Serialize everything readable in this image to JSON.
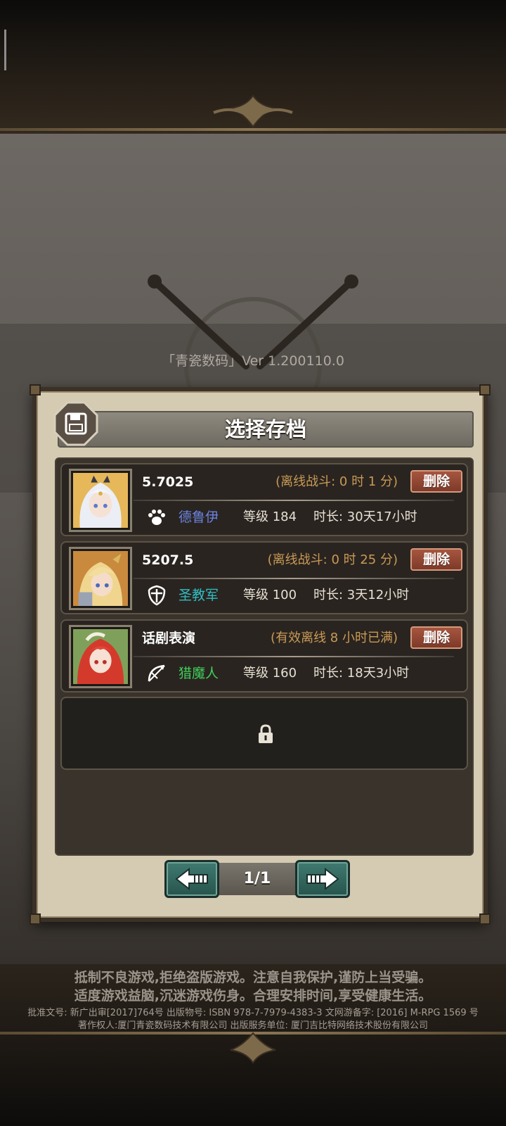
{
  "version_label": "「青瓷数码」Ver 1.200110.0",
  "dialog": {
    "title": "选择存档",
    "save_icon": "floppy-disk-icon",
    "slots": [
      {
        "name": "5.7025",
        "status": "(离线战斗:  0 时 1 分)",
        "delete_label": "删除",
        "class_icon": "paw-icon",
        "class_name": "德鲁伊",
        "class_color": "#6a83e0",
        "level": "等级 184",
        "duration": "时长: 30天17小时"
      },
      {
        "name": "5207.5",
        "status": "(离线战斗:  0 时 25 分)",
        "delete_label": "删除",
        "class_icon": "cross-shield-icon",
        "class_name": "圣教军",
        "class_color": "#2fbfc4",
        "level": "等级 100",
        "duration": "时长: 3天12小时"
      },
      {
        "name": "话剧表演",
        "status": "(有效离线 8 小时已满)",
        "delete_label": "删除",
        "class_icon": "crossbow-icon",
        "class_name": "猎魔人",
        "class_color": "#3fcf5a",
        "level": "等级 160",
        "duration": "时长: 18天3小时"
      }
    ],
    "locked_slot_icon": "lock-icon",
    "pager": {
      "prev_icon": "arrow-left-icon",
      "next_icon": "arrow-right-icon",
      "page": "1/1"
    }
  },
  "footer": {
    "notice_line1": "抵制不良游戏,拒绝盗版游戏。注意自我保护,谨防上当受骗。",
    "notice_line2": "适度游戏益脑,沉迷游戏伤身。合理安排时间,享受健康生活。",
    "legal_line1": "批准文号: 新广出审[2017]764号 出版物号: ISBN 978-7-7979-4383-3 文网游备字: [2016] M-RPG 1569 号",
    "legal_line2": "著作权人:厦门青瓷数码技术有限公司 出版服务单位: 厦门吉比特网络技术股份有限公司"
  },
  "colors": {
    "panel": "#d4cbb2",
    "slot_bg": "#2a2420",
    "delete_btn": "#a6553f",
    "pager_btn": "#3f7a70",
    "status_text": "#c99a55"
  }
}
